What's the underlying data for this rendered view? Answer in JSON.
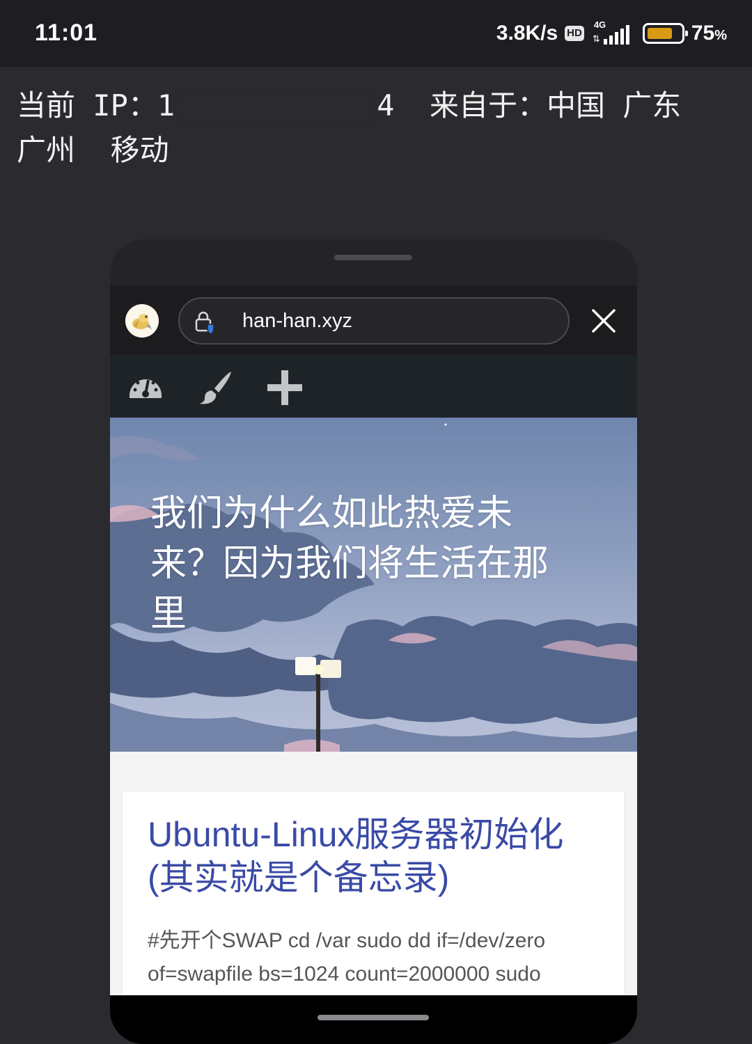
{
  "status_bar": {
    "time": "11:01",
    "net_speed": "3.8K/s",
    "hd_badge": "HD",
    "network_type": "4G",
    "battery_percent": "75",
    "battery_unit": "%",
    "battery_level": 0.75,
    "battery_color": "#d99a16"
  },
  "ip_info": {
    "line1_prefix": "当前 IP：1",
    "line1_suffix": "4  来自于：中国 广东",
    "line2": "广州  移动"
  },
  "browser": {
    "url": "han-han.xyz",
    "site_icon": "site-avatar-icon",
    "lock_icon": "lock-shield-icon",
    "close_icon": "close-icon"
  },
  "admin_toolbar": {
    "icons": [
      "dashboard-icon",
      "customize-brush-icon",
      "add-new-icon"
    ]
  },
  "hero": {
    "title": "我们为什么如此热爱未来？因为我们将生活在那里"
  },
  "post": {
    "title": "Ubuntu-Linux服务器初始化(其实就是个备忘录)",
    "excerpt": "#先开个SWAP cd /var sudo dd if=/dev/zero of=swapfile bs=1024 count=2000000 sudo"
  },
  "colors": {
    "post_title": "#3a4aa6",
    "admin_bar": "#1d2327",
    "page_bg": "#2a2a2f"
  }
}
